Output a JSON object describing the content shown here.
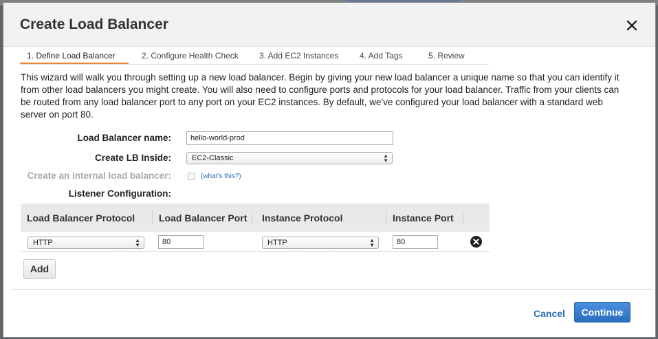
{
  "dialog": {
    "title": "Create Load Balancer",
    "close_icon": "close-icon"
  },
  "tabs": [
    {
      "label": "1. Define Load Balancer",
      "active": true
    },
    {
      "label": "2. Configure Health Check",
      "active": false
    },
    {
      "label": "3. Add EC2 Instances",
      "active": false
    },
    {
      "label": "4. Add Tags",
      "active": false
    },
    {
      "label": "5. Review",
      "active": false
    }
  ],
  "intro": "This wizard will walk you through setting up a new load balancer. Begin by giving your new load balancer a unique name so that you can identify it from other load balancers you might create. You will also need to configure ports and protocols for your load balancer. Traffic from your clients can be routed from any load balancer port to any port on your EC2 instances. By default, we've configured your load balancer with a standard web server on port 80.",
  "form": {
    "name_label": "Load Balancer name:",
    "name_value": "hello-world-prod",
    "inside_label": "Create LB Inside:",
    "inside_value": "EC2-Classic",
    "internal_label": "Create an internal load balancer:",
    "whats_this": "(what's this?)",
    "listener_label": "Listener Configuration:"
  },
  "listeners": {
    "headers": [
      "Load Balancer Protocol",
      "Load Balancer Port",
      "Instance Protocol",
      "Instance Port"
    ],
    "rows": [
      {
        "lb_protocol": "HTTP",
        "lb_port": "80",
        "instance_protocol": "HTTP",
        "instance_port": "80"
      }
    ]
  },
  "buttons": {
    "add": "Add",
    "cancel": "Cancel",
    "continue": "Continue"
  },
  "colors": {
    "accent_tab": "#e58a2e",
    "primary_button": "#2a6ec2",
    "link": "#2a6db0"
  }
}
